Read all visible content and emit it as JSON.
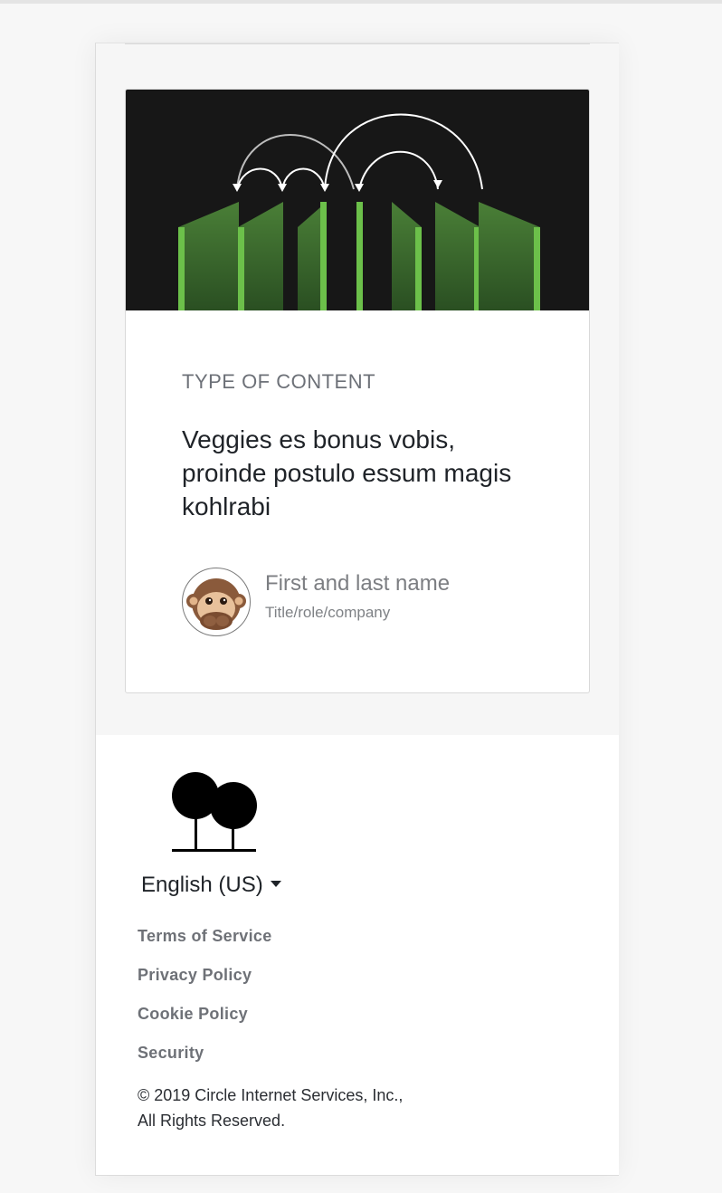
{
  "card": {
    "content_type": "TYPE OF CONTENT",
    "title": "Veggies es bonus vobis, proinde postulo essum magis kohlrabi",
    "author": {
      "name": "First and last name",
      "role": "Title/role/company"
    }
  },
  "footer": {
    "language": "English (US)",
    "links": [
      "Terms of Service",
      "Privacy Policy",
      "Cookie Policy",
      "Security"
    ],
    "copyright": "© 2019 Circle Internet Services, Inc., All Rights Reserved."
  },
  "colors": {
    "bar_green": "#3d6b2f",
    "bar_edge": "#6cc04a",
    "image_bg": "#171717"
  },
  "icons": {
    "avatar": "monkey-avatar-icon",
    "logo": "tree-logo-icon",
    "dropdown": "caret-down-icon"
  }
}
